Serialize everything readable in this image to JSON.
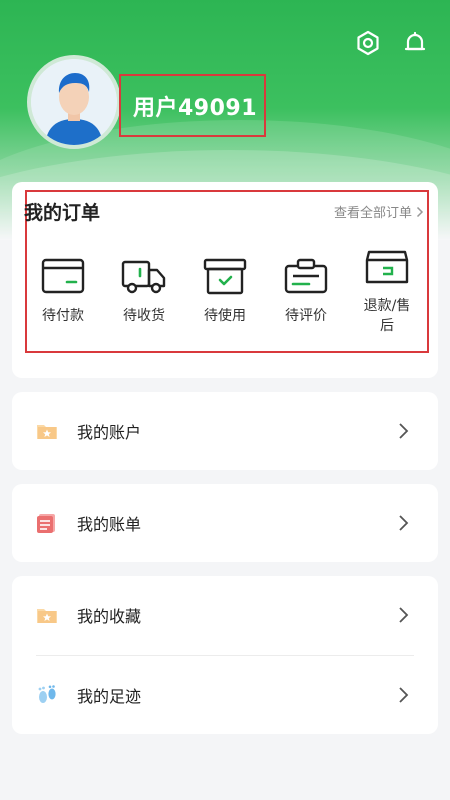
{
  "user": {
    "name": "用户49091"
  },
  "orders": {
    "title": "我的订单",
    "view_all": "查看全部订单",
    "items": [
      {
        "label": "待付款",
        "icon": "card-icon"
      },
      {
        "label": "待收货",
        "icon": "truck-icon"
      },
      {
        "label": "待使用",
        "icon": "box-check-icon"
      },
      {
        "label": "待评价",
        "icon": "clipboard-icon"
      },
      {
        "label": "退款/售后",
        "icon": "return-box-icon"
      }
    ]
  },
  "menu": {
    "account": {
      "label": "我的账户",
      "icon": "folder-star-icon"
    },
    "bill": {
      "label": "我的账单",
      "icon": "bill-icon"
    },
    "favorites": {
      "label": "我的收藏",
      "icon": "folder-star-icon"
    },
    "footprint": {
      "label": "我的足迹",
      "icon": "footprint-icon"
    }
  },
  "colors": {
    "brand_green": "#2db553",
    "highlight_red": "#d9393c",
    "icon_green": "#22b14c"
  }
}
